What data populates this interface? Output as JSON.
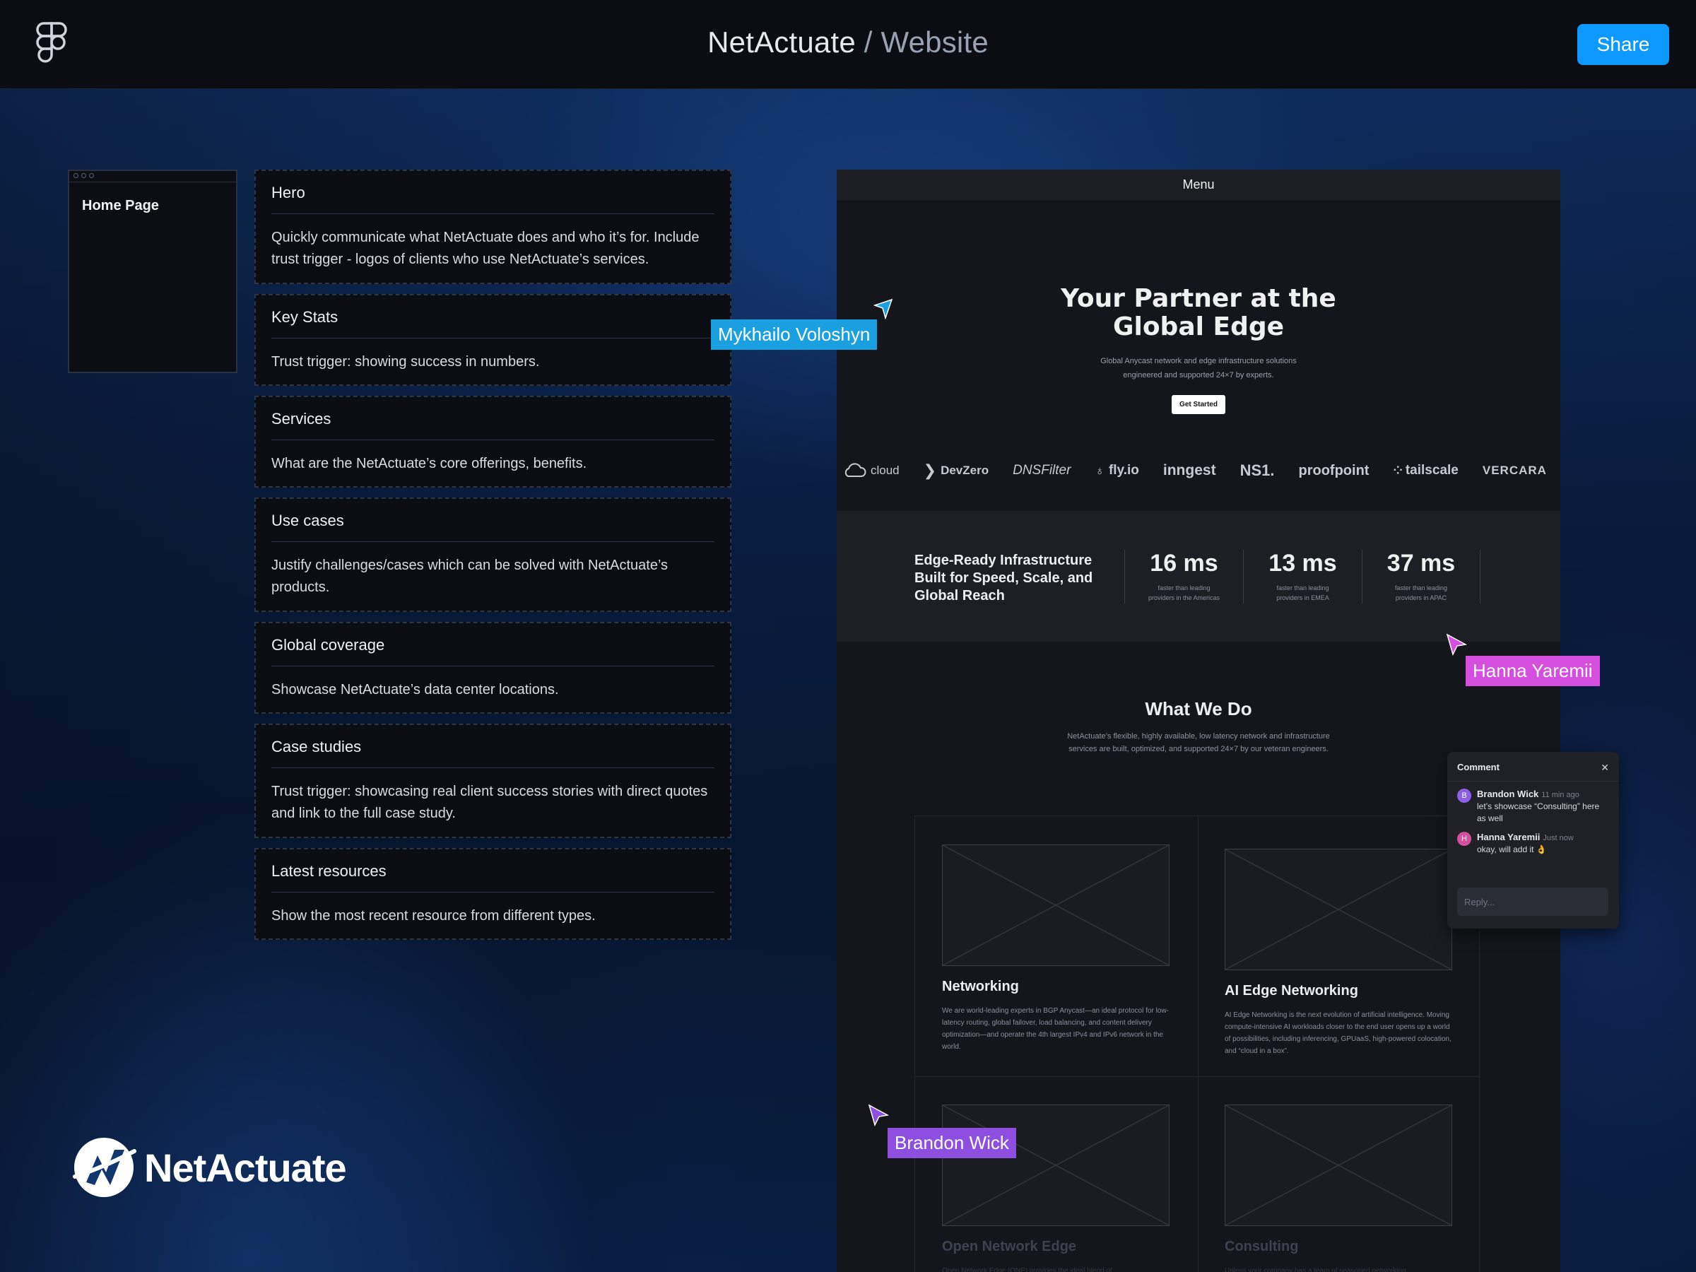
{
  "topbar": {
    "project": "NetActuate",
    "separator": " / ",
    "file": "Website",
    "share_label": "Share"
  },
  "home_frame": {
    "label": "Home Page"
  },
  "sections": [
    {
      "title": "Hero",
      "desc": "Quickly communicate what NetActuate does and who it’s for. Include trust trigger - logos of clients who use NetActuate’s services."
    },
    {
      "title": "Key Stats",
      "desc": "Trust trigger: showing success in numbers."
    },
    {
      "title": "Services",
      "desc": "What are the NetActuate’s core offerings, benefits."
    },
    {
      "title": "Use cases",
      "desc": "Justify challenges/cases which can be solved with NetActuate’s products."
    },
    {
      "title": "Global coverage",
      "desc": "Showcase NetActuate’s data center locations."
    },
    {
      "title": "Case studies",
      "desc": "Trust trigger: showcasing real client success stories with direct quotes and link to the full case study."
    },
    {
      "title": "Latest resources",
      "desc": "Show the most recent resource from different types."
    }
  ],
  "site": {
    "menu": "Menu",
    "hero": {
      "title_line1": "Your Partner at the",
      "title_line2": "Global Edge",
      "sub_line1": "Global Anycast network and edge infrastructure solutions",
      "sub_line2": "engineered and supported 24×7 by experts.",
      "cta": "Get Started"
    },
    "logos": [
      "cloud",
      "DevZero",
      "DNSFilter",
      "fly.io",
      "inngest",
      "NS1.",
      "proofpoint",
      "tailscale",
      "VERCARA"
    ],
    "stats": {
      "headline": "Edge-Ready Infrastructure Built for Speed, Scale, and Global Reach",
      "items": [
        {
          "value": "16 ms",
          "label_line1": "faster than leading",
          "label_line2": "providers in the Americas"
        },
        {
          "value": "13 ms",
          "label_line1": "faster than leading",
          "label_line2": "providers in EMEA"
        },
        {
          "value": "37 ms",
          "label_line1": "faster than leading",
          "label_line2": "providers in APAC"
        }
      ]
    },
    "what_we_do": {
      "title": "What We Do",
      "sub": "NetActuate’s flexible, highly available, low latency network and infrastructure services are built, optimized, and supported 24×7 by our veteran engineers.",
      "services": [
        {
          "title": "Networking",
          "desc": "We are world-leading experts in BGP Anycast—an ideal protocol for low-latency routing, global failover, load balancing, and content delivery optimization—and operate the 4th largest IPv4 and IPv6 network in the world."
        },
        {
          "title": "AI Edge Networking",
          "desc": "AI Edge Networking is the next evolution of artificial intelligence. Moving compute-intensive AI workloads closer to the end user opens up a world of possibilities, including inferencing, GPUaaS, high-powered colocation, and “cloud in a box”."
        },
        {
          "title": "Open Network Edge",
          "desc": "Open Network Edge (ONE) provides the ideal blend of"
        },
        {
          "title": "Consulting",
          "desc": "Unless your company has a team of seasoned networking"
        }
      ]
    }
  },
  "cursors": [
    {
      "name": "Mykhailo Voloshyn",
      "color": "#1aa0e0"
    },
    {
      "name": "Hanna Yaremii",
      "color": "#d64ee0"
    },
    {
      "name": "Brandon Wick",
      "color": "#8e4fe0"
    }
  ],
  "comment": {
    "title": "Comment",
    "messages": [
      {
        "initial": "B",
        "author": "Brandon Wick",
        "time": "11 min ago",
        "text": "let’s showcase “Consulting” here as well",
        "color": "#8e5fe6"
      },
      {
        "initial": "H",
        "author": "Hanna Yaremii",
        "time": "Just now",
        "text": "okay, will add it 👌",
        "color": "#d64ea0"
      }
    ],
    "reply_placeholder": "Reply..."
  },
  "brand": {
    "wordmark": "NetActuate"
  }
}
